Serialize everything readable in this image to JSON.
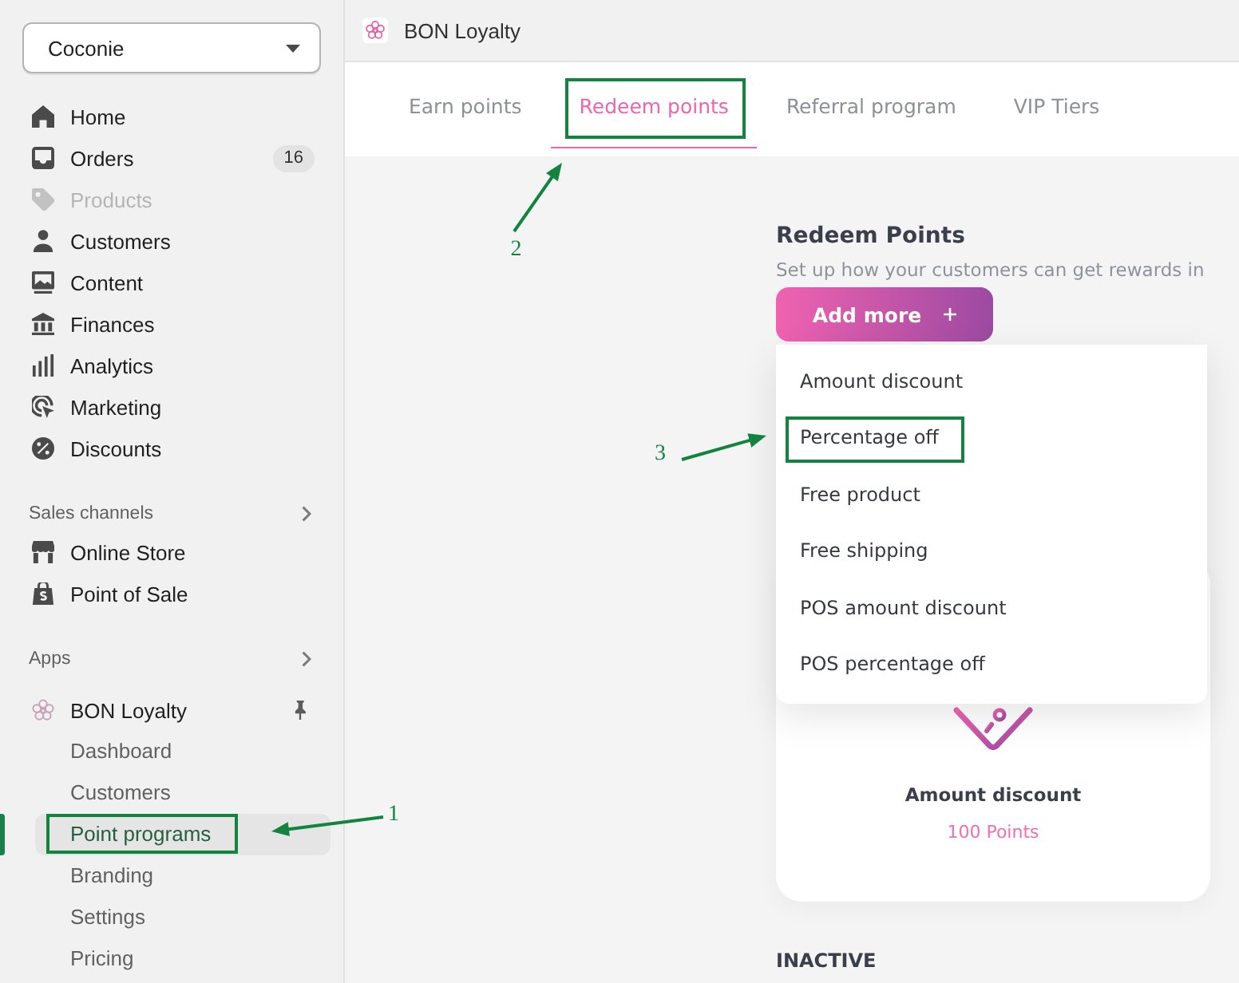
{
  "sidebar": {
    "store_selector": {
      "value": "Coconie"
    },
    "nav_items": [
      {
        "label": "Home",
        "disabled": false
      },
      {
        "label": "Orders",
        "badge": "16",
        "disabled": false
      },
      {
        "label": "Products",
        "disabled": true
      },
      {
        "label": "Customers",
        "disabled": false
      },
      {
        "label": "Content",
        "disabled": false
      },
      {
        "label": "Finances",
        "disabled": false
      },
      {
        "label": "Analytics",
        "disabled": false
      },
      {
        "label": "Marketing",
        "disabled": false
      },
      {
        "label": "Discounts",
        "disabled": false
      }
    ],
    "sales_channels": {
      "title": "Sales channels",
      "items": [
        {
          "label": "Online Store"
        },
        {
          "label": "Point of Sale"
        }
      ]
    },
    "apps": {
      "title": "Apps",
      "app_name": "BON Loyalty",
      "items": [
        {
          "label": "Dashboard",
          "selected": false
        },
        {
          "label": "Customers",
          "selected": false
        },
        {
          "label": "Point programs",
          "selected": true,
          "callout": "1"
        },
        {
          "label": "Branding",
          "selected": false
        },
        {
          "label": "Settings",
          "selected": false
        },
        {
          "label": "Pricing",
          "selected": false
        }
      ]
    }
  },
  "app_bar": {
    "title": "BON Loyalty"
  },
  "tabs": [
    {
      "label": "Earn points",
      "selected": false
    },
    {
      "label": "Redeem points",
      "selected": true,
      "callout": "2"
    },
    {
      "label": "Referral program",
      "selected": false
    },
    {
      "label": "VIP Tiers",
      "selected": false
    }
  ],
  "redeem_section": {
    "title": "Redeem Points",
    "subtitle": "Set up how your customers can get rewards in",
    "add_button": {
      "label": "Add more"
    },
    "add_menu": [
      {
        "label": "Amount discount"
      },
      {
        "label": "Percentage off",
        "callout": "3"
      },
      {
        "label": "Free product"
      },
      {
        "label": "Free shipping"
      },
      {
        "label": "POS amount discount"
      },
      {
        "label": "POS percentage off"
      }
    ],
    "reward_card": {
      "title": "Amount discount",
      "points": "100 Points"
    },
    "inactive_heading": "INACTIVE"
  }
}
